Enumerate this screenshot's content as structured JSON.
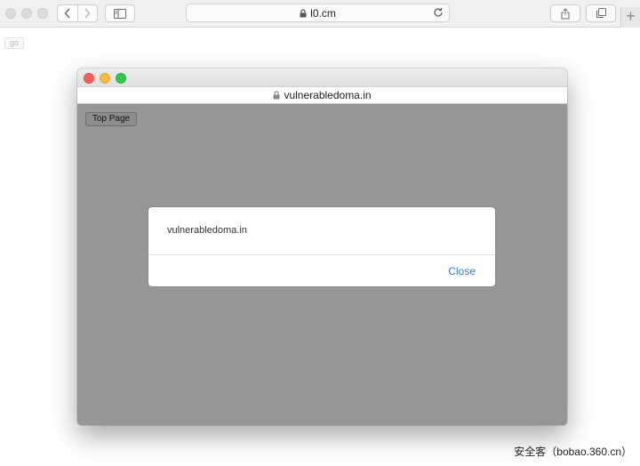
{
  "browser": {
    "url": "l0.cm",
    "plus_label": "+"
  },
  "page": {
    "go_label": "go"
  },
  "popup": {
    "url": "vulnerabledoma.in",
    "top_page_label": "Top Page"
  },
  "alert": {
    "message": "vulnerabledoma.in",
    "close_label": "Close"
  },
  "watermark": "安全客（bobao.360.cn）",
  "colors": {
    "popup_overlay": "#969696",
    "link_blue": "#2f7bd9",
    "traffic_red": "#fc605b",
    "traffic_yellow": "#fdbc40",
    "traffic_green": "#34c84a"
  }
}
